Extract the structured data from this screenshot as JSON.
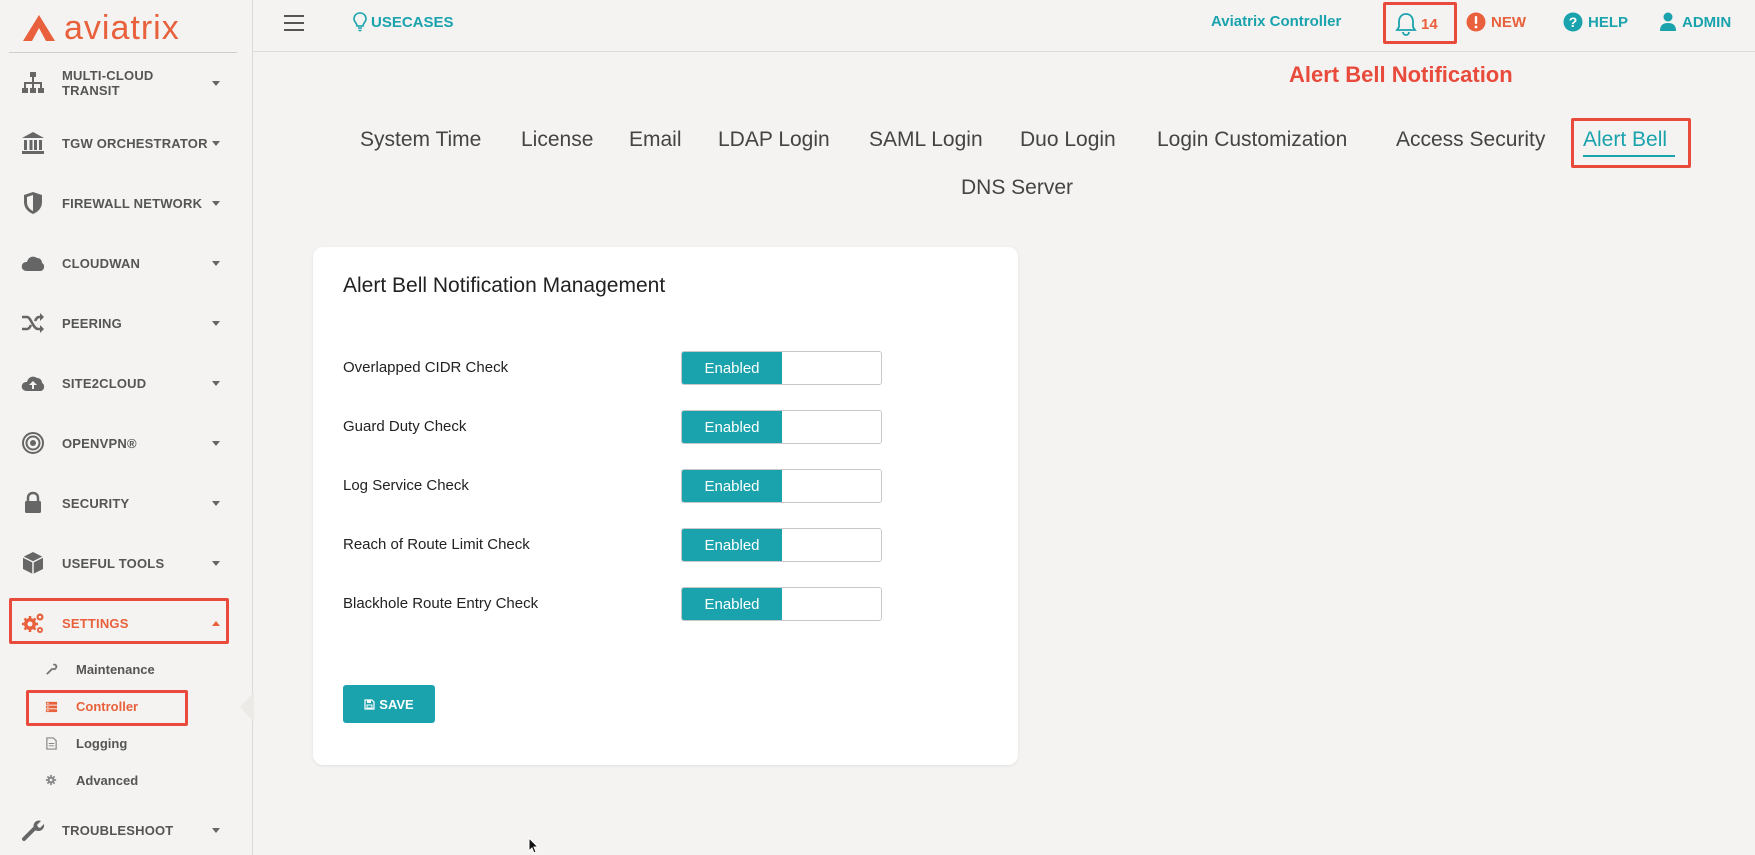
{
  "brand": {
    "name": "aviatrix",
    "color": "#e8613c",
    "accent": "#1aa3ad"
  },
  "sidebar": {
    "items": [
      {
        "label": "MULTI-CLOUD TRANSIT",
        "icon": "network-icon"
      },
      {
        "label": "TGW ORCHESTRATOR",
        "icon": "bank-icon"
      },
      {
        "label": "FIREWALL NETWORK",
        "icon": "shield-icon"
      },
      {
        "label": "CLOUDWAN",
        "icon": "cloud-icon"
      },
      {
        "label": "PEERING",
        "icon": "shuffle-icon"
      },
      {
        "label": "SITE2CLOUD",
        "icon": "cloud-upload-icon"
      },
      {
        "label": "OPENVPN®",
        "icon": "target-icon"
      },
      {
        "label": "SECURITY",
        "icon": "lock-icon"
      },
      {
        "label": "USEFUL TOOLS",
        "icon": "cube-icon"
      },
      {
        "label": "SETTINGS",
        "icon": "gears-icon",
        "active": true
      },
      {
        "label": "TROUBLESHOOT",
        "icon": "wrench-icon"
      }
    ],
    "settings_sub": [
      {
        "label": "Maintenance",
        "icon": "wrench-icon"
      },
      {
        "label": "Controller",
        "icon": "server-icon",
        "active": true
      },
      {
        "label": "Logging",
        "icon": "document-icon"
      },
      {
        "label": "Advanced",
        "icon": "gear-icon"
      }
    ]
  },
  "topbar": {
    "usecases": "USECASES",
    "controller_name": "Aviatrix Controller",
    "bell_count": "14",
    "new": "NEW",
    "help": "HELP",
    "admin": "ADMIN"
  },
  "annotation": "Alert Bell Notification",
  "tabs": [
    "System Time",
    "License",
    "Email",
    "LDAP Login",
    "SAML Login",
    "Duo Login",
    "Login Customization",
    "Access Security",
    "Alert Bell",
    "DNS Server"
  ],
  "active_tab": "Alert Bell",
  "card": {
    "title": "Alert Bell Notification Management",
    "rows": [
      {
        "label": "Overlapped CIDR Check",
        "state": "Enabled"
      },
      {
        "label": "Guard Duty Check",
        "state": "Enabled"
      },
      {
        "label": "Log Service Check",
        "state": "Enabled"
      },
      {
        "label": "Reach of Route Limit Check",
        "state": "Enabled"
      },
      {
        "label": "Blackhole Route Entry Check",
        "state": "Enabled"
      }
    ],
    "save_label": "SAVE"
  },
  "colors": {
    "highlight": "#e84b3c",
    "teal": "#1aa3ad",
    "orange": "#e8613c"
  }
}
